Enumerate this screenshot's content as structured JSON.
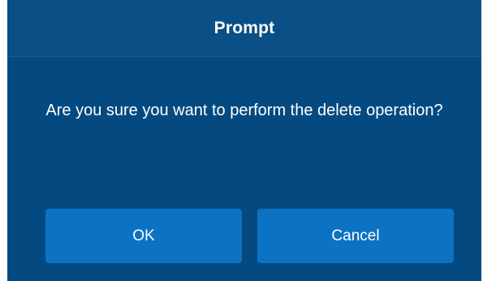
{
  "dialog": {
    "title": "Prompt",
    "message": "Are you sure you want to perform the delete operation?",
    "ok_label": "OK",
    "cancel_label": "Cancel"
  },
  "colors": {
    "dialog_background": "#044a80",
    "header_background": "#0a4f85",
    "button_background": "#0c72c4",
    "text": "#ffffff"
  }
}
